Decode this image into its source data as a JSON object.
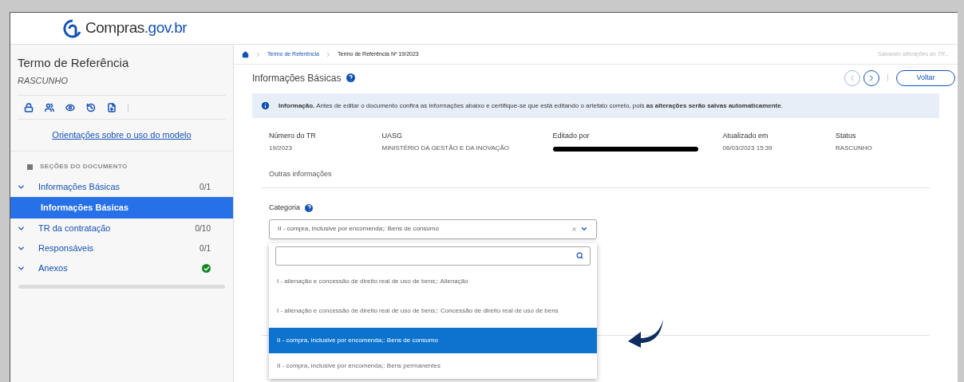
{
  "logo": {
    "text": "Compras",
    "suffix": ".gov.br"
  },
  "sidebar": {
    "title": "Termo de Referência",
    "subtitle": "RASCUNHO",
    "guide_link": "Orientações sobre o uso do modelo",
    "sections_heading": "SEÇÕES DO DOCUMENTO",
    "items": [
      {
        "label": "Informações Básicas",
        "count": "0/1",
        "complete": false,
        "children": [
          {
            "label": "Informações Básicas",
            "selected": true
          }
        ]
      },
      {
        "label": "TR da contratação",
        "count": "0/10",
        "complete": false
      },
      {
        "label": "Responsáveis",
        "count": "0/1",
        "complete": false
      },
      {
        "label": "Anexos",
        "complete": true
      }
    ]
  },
  "breadcrumb": [
    "Termo de Referência",
    "Termo de Referência Nº 19/2023"
  ],
  "save_status": "Salvando alterações do TR...",
  "page_title": "Informações Básicas",
  "back_button": "Voltar",
  "info_banner": "**Informação.** Antes de editar o documento confira as informações abaixo e certifique-se que está editando o artefato correto, pois **as alterações serão salvas automaticamente**.",
  "fields": [
    {
      "label": "Número do TR",
      "value": "19/2023",
      "redacted": false
    },
    {
      "label": "UASG",
      "value": "MINISTÉRIO DA GESTÃO E DA INOVAÇÃO",
      "redacted": false
    },
    {
      "label": "Editado por",
      "redacted": true
    },
    {
      "label": "Atualizado em",
      "value": "06/03/2023 15:39",
      "redacted": false
    },
    {
      "label": "Status",
      "value": "RASCUNHO",
      "redacted": false
    }
  ],
  "other_info": "Outras informações",
  "category": {
    "label": "Categoria",
    "value": "II - compra, inclusive por encomenda;: Bens de consumo",
    "options": [
      {
        "label": "I - alienação e concessão de direito real de uso de bens;: Alienação",
        "selected": false
      },
      {
        "label": "I - alienação e concessão de direito real de uso de bens;: Concessão de direito real de uso de bens",
        "selected": false
      },
      {
        "label": "II - compra, inclusive por encomenda;: Bens de consumo",
        "selected": true
      },
      {
        "label": "II - compra, inclusive por encomenda;: Bens permanentes",
        "selected": false
      }
    ]
  }
}
